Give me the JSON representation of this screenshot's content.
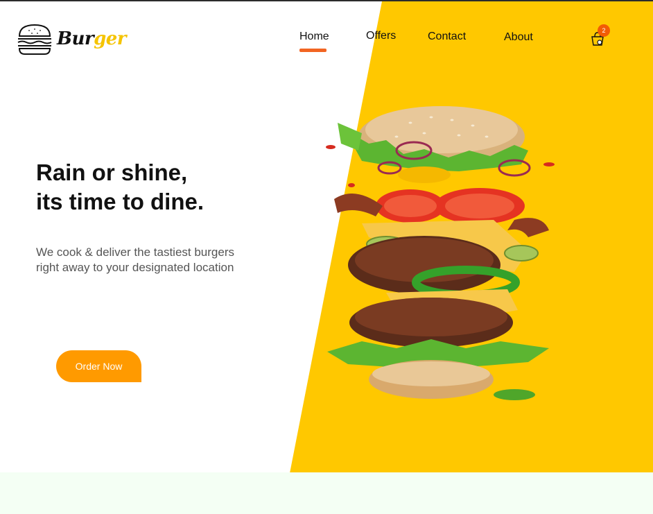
{
  "brand": {
    "name_part1": "Bur",
    "name_part2": "ger"
  },
  "nav": {
    "home": "Home",
    "offers": "Offers",
    "contact": "Contact",
    "about": "About",
    "active": "Home"
  },
  "cart": {
    "count": "2"
  },
  "hero": {
    "headline_line1": "Rain or shine,",
    "headline_line2": "its time to dine.",
    "subtext_line1": "We cook & deliver the tastiest burgers",
    "subtext_line2": "right away to your designated location",
    "cta_label": "Order Now"
  },
  "colors": {
    "accent_yellow": "#ffc800",
    "brand_yellow": "#f5c400",
    "cta_orange": "#ff9a00",
    "nav_underline": "#f26522",
    "badge": "#f25c05",
    "bottom_band": "#f4fff4"
  },
  "icons": [
    "burger-logo-icon",
    "shopping-bag-icon"
  ]
}
